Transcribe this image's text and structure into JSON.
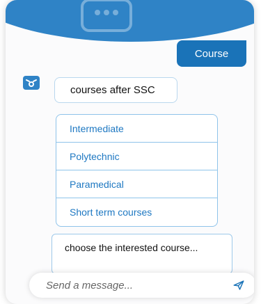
{
  "header": {
    "faded_text": "· · · · · · · · · · ·"
  },
  "chat": {
    "user_message": "Course",
    "bot_message": "courses after SSC",
    "options": [
      "Intermediate",
      "Polytechnic",
      "Paramedical",
      "Short term courses"
    ],
    "prompt_text": "choose the interested course..."
  },
  "composer": {
    "placeholder": "Send a message..."
  },
  "colors": {
    "primary": "#2f83c6",
    "user_bubble": "#1a73b8",
    "option_text": "#1e78c2",
    "option_border": "#8ec3ea"
  },
  "icons": {
    "bot_avatar": "bot-face-icon",
    "send": "send-paper-plane-icon",
    "header": "chat-bubble-icon"
  }
}
